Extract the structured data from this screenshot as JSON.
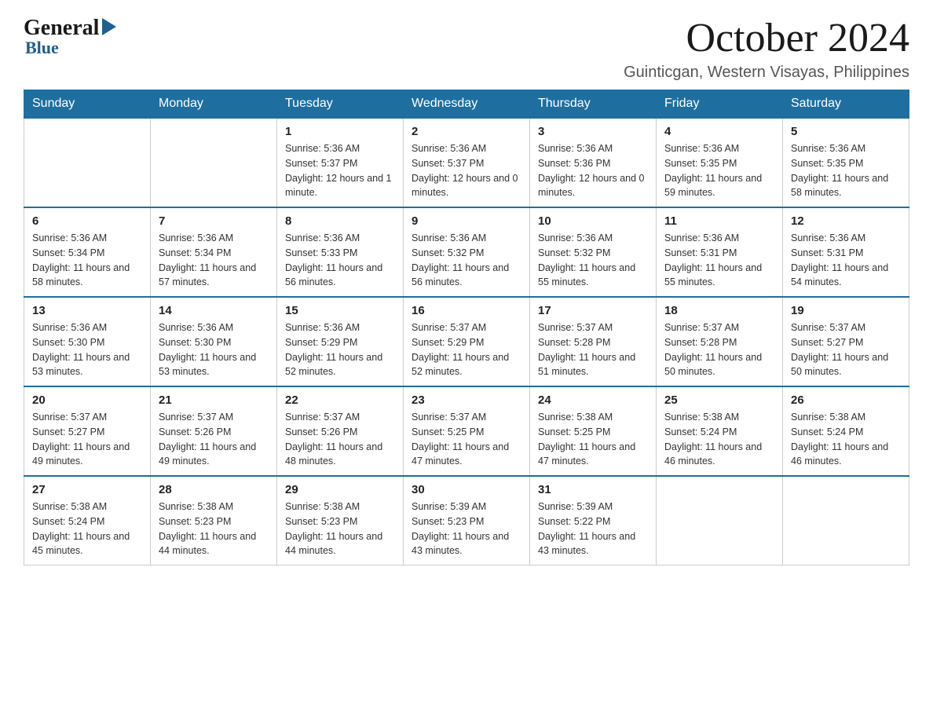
{
  "logo": {
    "general": "General",
    "blue": "Blue"
  },
  "header": {
    "month_year": "October 2024",
    "location": "Guinticgan, Western Visayas, Philippines"
  },
  "weekdays": [
    "Sunday",
    "Monday",
    "Tuesday",
    "Wednesday",
    "Thursday",
    "Friday",
    "Saturday"
  ],
  "weeks": [
    [
      {
        "day": "",
        "info": ""
      },
      {
        "day": "",
        "info": ""
      },
      {
        "day": "1",
        "info": "Sunrise: 5:36 AM\nSunset: 5:37 PM\nDaylight: 12 hours\nand 1 minute."
      },
      {
        "day": "2",
        "info": "Sunrise: 5:36 AM\nSunset: 5:37 PM\nDaylight: 12 hours\nand 0 minutes."
      },
      {
        "day": "3",
        "info": "Sunrise: 5:36 AM\nSunset: 5:36 PM\nDaylight: 12 hours\nand 0 minutes."
      },
      {
        "day": "4",
        "info": "Sunrise: 5:36 AM\nSunset: 5:35 PM\nDaylight: 11 hours\nand 59 minutes."
      },
      {
        "day": "5",
        "info": "Sunrise: 5:36 AM\nSunset: 5:35 PM\nDaylight: 11 hours\nand 58 minutes."
      }
    ],
    [
      {
        "day": "6",
        "info": "Sunrise: 5:36 AM\nSunset: 5:34 PM\nDaylight: 11 hours\nand 58 minutes."
      },
      {
        "day": "7",
        "info": "Sunrise: 5:36 AM\nSunset: 5:34 PM\nDaylight: 11 hours\nand 57 minutes."
      },
      {
        "day": "8",
        "info": "Sunrise: 5:36 AM\nSunset: 5:33 PM\nDaylight: 11 hours\nand 56 minutes."
      },
      {
        "day": "9",
        "info": "Sunrise: 5:36 AM\nSunset: 5:32 PM\nDaylight: 11 hours\nand 56 minutes."
      },
      {
        "day": "10",
        "info": "Sunrise: 5:36 AM\nSunset: 5:32 PM\nDaylight: 11 hours\nand 55 minutes."
      },
      {
        "day": "11",
        "info": "Sunrise: 5:36 AM\nSunset: 5:31 PM\nDaylight: 11 hours\nand 55 minutes."
      },
      {
        "day": "12",
        "info": "Sunrise: 5:36 AM\nSunset: 5:31 PM\nDaylight: 11 hours\nand 54 minutes."
      }
    ],
    [
      {
        "day": "13",
        "info": "Sunrise: 5:36 AM\nSunset: 5:30 PM\nDaylight: 11 hours\nand 53 minutes."
      },
      {
        "day": "14",
        "info": "Sunrise: 5:36 AM\nSunset: 5:30 PM\nDaylight: 11 hours\nand 53 minutes."
      },
      {
        "day": "15",
        "info": "Sunrise: 5:36 AM\nSunset: 5:29 PM\nDaylight: 11 hours\nand 52 minutes."
      },
      {
        "day": "16",
        "info": "Sunrise: 5:37 AM\nSunset: 5:29 PM\nDaylight: 11 hours\nand 52 minutes."
      },
      {
        "day": "17",
        "info": "Sunrise: 5:37 AM\nSunset: 5:28 PM\nDaylight: 11 hours\nand 51 minutes."
      },
      {
        "day": "18",
        "info": "Sunrise: 5:37 AM\nSunset: 5:28 PM\nDaylight: 11 hours\nand 50 minutes."
      },
      {
        "day": "19",
        "info": "Sunrise: 5:37 AM\nSunset: 5:27 PM\nDaylight: 11 hours\nand 50 minutes."
      }
    ],
    [
      {
        "day": "20",
        "info": "Sunrise: 5:37 AM\nSunset: 5:27 PM\nDaylight: 11 hours\nand 49 minutes."
      },
      {
        "day": "21",
        "info": "Sunrise: 5:37 AM\nSunset: 5:26 PM\nDaylight: 11 hours\nand 49 minutes."
      },
      {
        "day": "22",
        "info": "Sunrise: 5:37 AM\nSunset: 5:26 PM\nDaylight: 11 hours\nand 48 minutes."
      },
      {
        "day": "23",
        "info": "Sunrise: 5:37 AM\nSunset: 5:25 PM\nDaylight: 11 hours\nand 47 minutes."
      },
      {
        "day": "24",
        "info": "Sunrise: 5:38 AM\nSunset: 5:25 PM\nDaylight: 11 hours\nand 47 minutes."
      },
      {
        "day": "25",
        "info": "Sunrise: 5:38 AM\nSunset: 5:24 PM\nDaylight: 11 hours\nand 46 minutes."
      },
      {
        "day": "26",
        "info": "Sunrise: 5:38 AM\nSunset: 5:24 PM\nDaylight: 11 hours\nand 46 minutes."
      }
    ],
    [
      {
        "day": "27",
        "info": "Sunrise: 5:38 AM\nSunset: 5:24 PM\nDaylight: 11 hours\nand 45 minutes."
      },
      {
        "day": "28",
        "info": "Sunrise: 5:38 AM\nSunset: 5:23 PM\nDaylight: 11 hours\nand 44 minutes."
      },
      {
        "day": "29",
        "info": "Sunrise: 5:38 AM\nSunset: 5:23 PM\nDaylight: 11 hours\nand 44 minutes."
      },
      {
        "day": "30",
        "info": "Sunrise: 5:39 AM\nSunset: 5:23 PM\nDaylight: 11 hours\nand 43 minutes."
      },
      {
        "day": "31",
        "info": "Sunrise: 5:39 AM\nSunset: 5:22 PM\nDaylight: 11 hours\nand 43 minutes."
      },
      {
        "day": "",
        "info": ""
      },
      {
        "day": "",
        "info": ""
      }
    ]
  ]
}
